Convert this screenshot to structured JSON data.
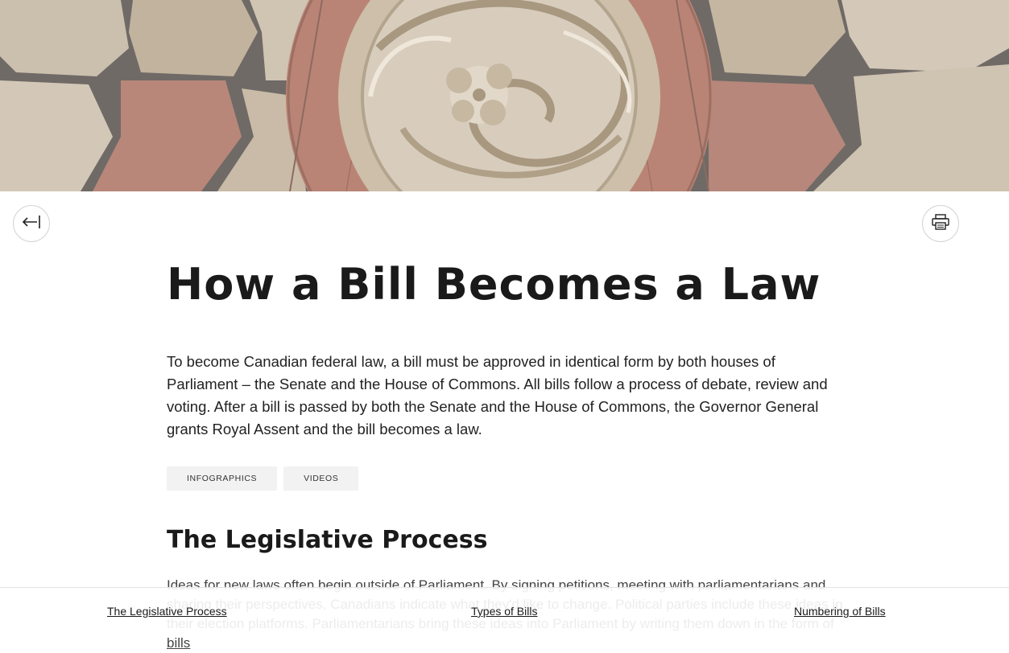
{
  "hero": {
    "image_description": "stone carving banner",
    "colors": {
      "stone": "#cfc4b3",
      "mortar": "#6f6a66",
      "red_stone": "#b98476",
      "carving": "#d8cdbd"
    }
  },
  "toolbar": {
    "back_icon": "collapse-left-icon",
    "print_icon": "printer-icon"
  },
  "page": {
    "title": "How a Bill Becomes a Law",
    "intro": "To become Canadian federal law, a bill must be approved in identical form by both houses of Parliament – the Senate and the House of Commons. All bills follow a process of debate, review and voting. After a bill is passed by both the Senate and the House of Commons, the Governor General grants Royal Assent and the bill becomes a law."
  },
  "tags": [
    {
      "label": "INFOGRAPHICS"
    },
    {
      "label": "VIDEOS"
    }
  ],
  "section": {
    "heading": "The Legislative Process",
    "body_part1": "Ideas for new laws often begin outside of Parliament. By signing petitions, meeting with parliamentarians and sharing their perspectives, Canadians indicate what they'd like to change. Political parties include these ideas in their election platforms. Parliamentarians bring these ideas into Parliament by writing them down in the form of ",
    "body_link": "bills"
  },
  "footer_nav": [
    {
      "label": "The Legislative Process"
    },
    {
      "label": "Types of Bills"
    },
    {
      "label": "Numbering of Bills"
    }
  ]
}
